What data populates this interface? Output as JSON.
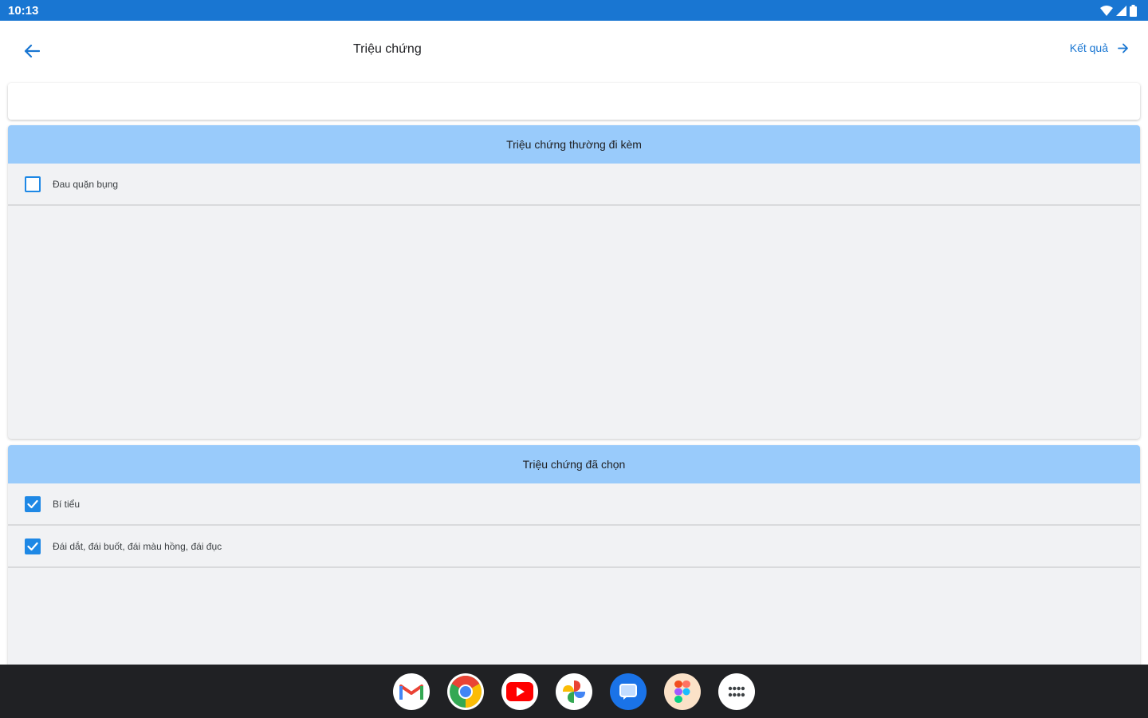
{
  "status_bar": {
    "time": "10:13"
  },
  "header": {
    "title": "Triệu chứng",
    "result_label": "Kết quả"
  },
  "search": {
    "value": "",
    "placeholder": ""
  },
  "accompanying": {
    "header": "Triệu chứng thường đi kèm",
    "items": [
      {
        "label": "Đau quặn bụng",
        "checked": false
      }
    ]
  },
  "selected": {
    "header": "Triệu chứng đã chọn",
    "items": [
      {
        "label": "Bí tiểu",
        "checked": true
      },
      {
        "label": "Đái dắt, đái buốt, đái màu hồng, đái đục",
        "checked": true
      }
    ]
  },
  "taskbar": {
    "apps": [
      "gmail-icon",
      "chrome-icon",
      "youtube-icon",
      "photos-icon",
      "messages-icon",
      "figma-icon",
      "app-drawer-icon"
    ]
  },
  "colors": {
    "primary": "#1976d2",
    "header_bg": "#99cbfb",
    "card_bg": "#f1f2f4",
    "checkbox": "#1e88e5",
    "taskbar": "#202124"
  }
}
